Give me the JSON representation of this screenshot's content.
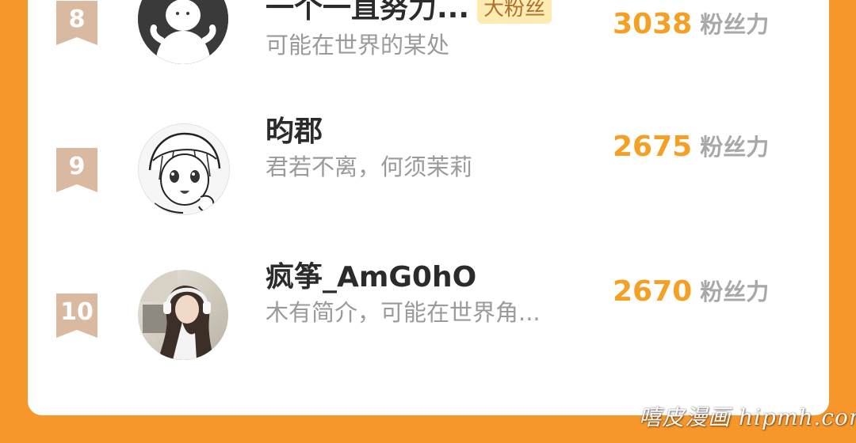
{
  "ranking": {
    "rows": [
      {
        "rank": "8",
        "name": "一个一直努力...",
        "badge": "大粉丝",
        "intro": "可能在世界的某处",
        "fans_value": "3038",
        "fans_unit": "粉丝力",
        "avatar": "default-person-avatar"
      },
      {
        "rank": "9",
        "name": "昀郡",
        "intro": "君若不离，何须茉莉",
        "fans_value": "2675",
        "fans_unit": "粉丝力",
        "avatar": "anime-girl-sketch-avatar"
      },
      {
        "rank": "10",
        "name": "疯筝_AmG0hO",
        "intro": "木有简介，可能在世界角...",
        "fans_value": "2670",
        "fans_unit": "粉丝力",
        "avatar": "girl-with-headphones-photo-avatar"
      }
    ]
  },
  "watermark": "嘻皮漫画 hipmh.com",
  "colors": {
    "background": "#f7962a",
    "card": "#ffffff",
    "rank_ribbon": "#d9b9a0",
    "fans_value": "#f3a024",
    "badge_bg": "#fdecb2",
    "badge_text": "#b0712d"
  }
}
